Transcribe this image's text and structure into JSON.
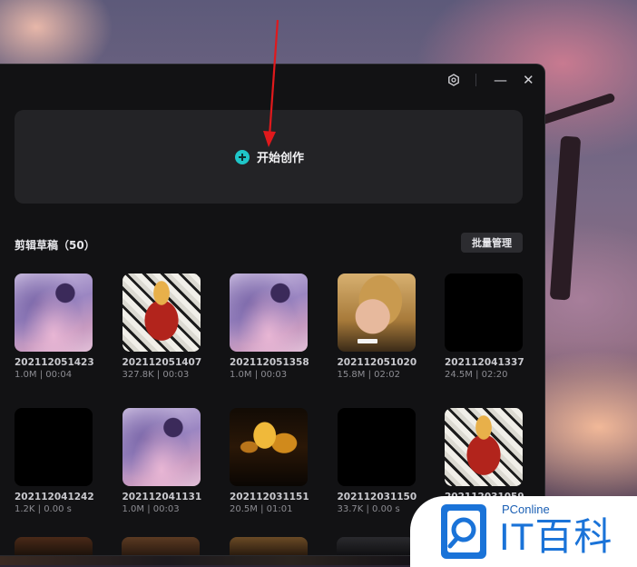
{
  "window": {
    "controls": {
      "settings": "⬡",
      "minimize": "—",
      "close": "✕"
    }
  },
  "create": {
    "label": "开始创作"
  },
  "drafts": {
    "title": "剪辑草稿（50）",
    "batch_label": "批量管理",
    "items": [
      {
        "name": "202112051423",
        "meta": "1.0M | 00:04",
        "thumb": "anime-purple"
      },
      {
        "name": "202112051407",
        "meta": "327.8K | 00:03",
        "thumb": "ninja"
      },
      {
        "name": "202112051358",
        "meta": "1.0M | 00:03",
        "thumb": "anime-purple"
      },
      {
        "name": "202112051020",
        "meta": "15.8M | 02:02",
        "thumb": "monkey"
      },
      {
        "name": "202112041337",
        "meta": "24.5M | 02:20",
        "thumb": "black"
      },
      {
        "name": "202112041242",
        "meta": "1.2K | 0.00 s",
        "thumb": "black"
      },
      {
        "name": "202112041131",
        "meta": "1.0M | 00:03",
        "thumb": "anime-purple"
      },
      {
        "name": "202112031151",
        "meta": "20.5M | 01:01",
        "thumb": "gold"
      },
      {
        "name": "202112031150",
        "meta": "33.7K | 0.00 s",
        "thumb": "black"
      },
      {
        "name": "202112031059",
        "meta": "",
        "thumb": "ninja"
      }
    ]
  },
  "watermark": {
    "brand_small": "PConline",
    "brand_large": "IT百科"
  },
  "colors": {
    "accent": "#1fc6c8",
    "annotation": "#e0191c",
    "logo_blue": "#1a73d8"
  }
}
